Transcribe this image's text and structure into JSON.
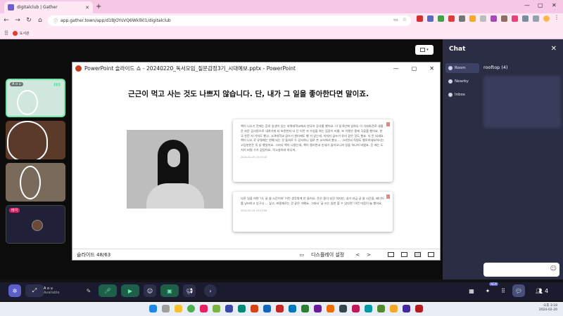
{
  "browser": {
    "tab_title": "digitalclub | Gather",
    "new_tab": "+",
    "url": "app.gather.town/app/d1BJOYsVQ6Wkllkl1/digitalclub",
    "bookmark_label": "도서관"
  },
  "powerpoint": {
    "window_title": "PowerPoint 슬라이드 쇼  -  20240220_독서모임_질문감정3기_시대예보.pptx  -  PowerPoint",
    "slide_headline": "근근이 먹고 사는 것도 나쁘지 않습니다. 단, 내가 그 일을 좋아한다면 말이죠.",
    "card1_text": "책이 나오기 전에는 흔히 송생이 있는 지역대학교에서 한국어 강사를 했어요. 이 일 6년에 일하다 이 기자회견로 새롭운 자문 감사원으로 내려가게 되 보관한지 다 단 이런 저 수업을 하는 집장이 비율. 또 이렇은 중에 곡류를 했어요. 한국 친문 자 거저도 했고, 고려대학교 글쓰기 센터에도 했 거 있는데, 저저저 글쓰기 유리 같은 것도 했죠. 다 돈 되세요. 책이 나오 로 유명해는 연예 되는 것 들처로 두 강사하니 일로 손 교사에서 했고 ... 그러면서 직원도 했로하세요하시는 고당분한돈 독 읽 했었어요. 그러다 책이 나왔는데, 책이 팔리면서 인세가 들어오니까 일을 하나씩 버렸죠. 진 에는 도저히 버릴 수가 없었어요. 먹고살아야 하니까.",
    "card1_date": "2024-02-19 23:23:43",
    "card2_text": "다른 일을 하면 '아, 글 쓸 시간이야' 이런 생각밖에 안 들어요. 돈은 좀이 되진 하지만, 내가 지금 글 쓸 시간을, 배너어를 낭비하고 있구나 ... 싶고, 버릴재로는 것 같은 거예요. 그래서 '글 쓰는 일한 할 수 있다면' 이런 마음이 늘 했어요.",
    "card2_date": "2024-02-19 23:23:50",
    "slide_counter": "슬라이드 48/63",
    "display_settings": "디스플레이 설정",
    "prev": "<",
    "next": ">"
  },
  "participants": [
    {
      "name": "A o u"
    },
    {
      "name": ""
    },
    {
      "name": ""
    },
    {
      "name": "태극"
    }
  ],
  "chat": {
    "title": "Chat",
    "close": "✕",
    "nav": [
      {
        "label": "Room"
      },
      {
        "label": "Nearby"
      },
      {
        "label": "Inbox"
      }
    ],
    "room_title": "rooftop (4)",
    "emoji": "☺"
  },
  "toolbar": {
    "user_name": "A o u",
    "user_status": "Available",
    "participant_count": "4",
    "badge": "NEW"
  },
  "taskbar": {
    "clock_top": "오후 3:18",
    "clock_bottom": "2024-02-20"
  },
  "colors": {
    "browser_chrome": "#f6c8e6",
    "gather_bg": "#121212",
    "chat_panel": "#2a2d44",
    "toolbar_bg": "#1a1b2e",
    "accent_green": "#6ee7a8",
    "accent_purple": "#5b5fc7"
  }
}
